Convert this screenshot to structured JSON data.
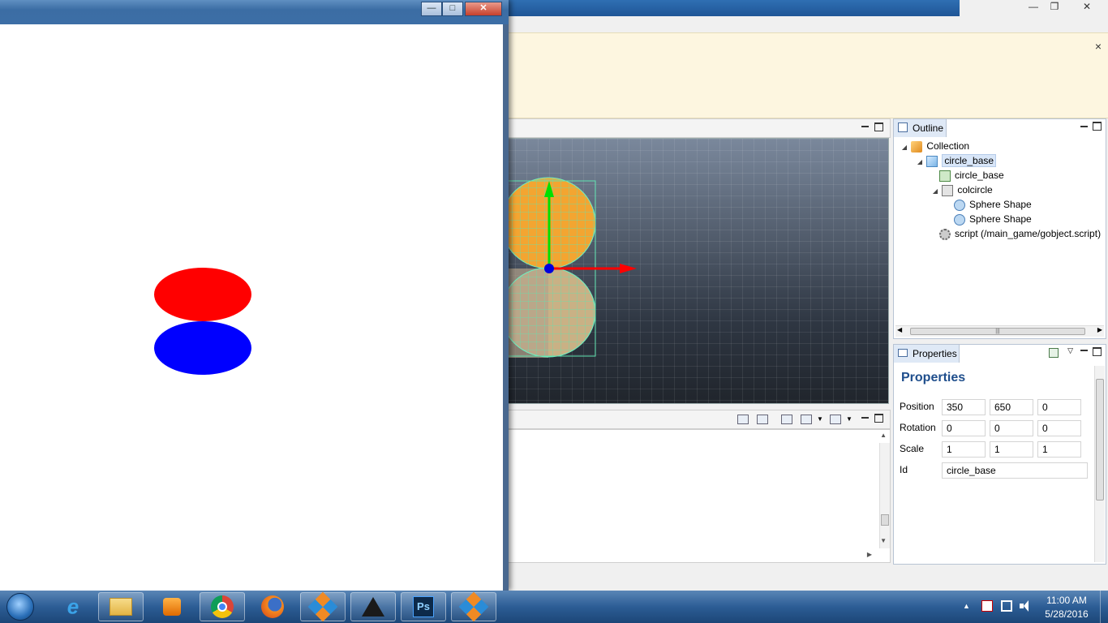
{
  "editor": {
    "notice_close": "×",
    "window_buttons": {
      "minimize": "—",
      "maximize": "❐",
      "close": "✕"
    }
  },
  "outline": {
    "tab_label": "Outline",
    "tree": [
      {
        "label": "Collection",
        "icon": "collection-icon",
        "arrow": "◢"
      },
      {
        "label": "circle_base",
        "icon": "gameobject-icon",
        "arrow": "◢",
        "selected": true
      },
      {
        "label": "circle_base",
        "icon": "sprite-icon"
      },
      {
        "label": "colcircle",
        "icon": "collision-icon",
        "arrow": "◢"
      },
      {
        "label": "Sphere Shape",
        "icon": "sphere-icon"
      },
      {
        "label": "Sphere Shape",
        "icon": "sphere-icon"
      },
      {
        "label": "script (/main_game/gobject.script)",
        "icon": "gear-icon"
      }
    ],
    "scroll_grip": "|||"
  },
  "properties": {
    "tab_label": "Properties",
    "title": "Properties",
    "rows": {
      "position": {
        "label": "Position",
        "x": "350",
        "y": "650",
        "z": "0"
      },
      "rotation": {
        "label": "Rotation",
        "x": "0",
        "y": "0",
        "z": "0"
      },
      "scale": {
        "label": "Scale",
        "x": "1",
        "y": "1",
        "z": "1"
      },
      "id": {
        "label": "Id",
        "value": "circle_base"
      }
    }
  },
  "game_window": {
    "buttons": {
      "minimize": "—",
      "maximize": "□",
      "close": "✕"
    },
    "circles": [
      {
        "color": "#ff0000"
      },
      {
        "color": "#0000ff"
      }
    ]
  },
  "taskbar": {
    "clock_time": "11:00 AM",
    "clock_date": "5/28/2016",
    "tray_arrow": "▲",
    "apps": [
      "start-orb",
      "internet-explorer-icon",
      "file-explorer-icon",
      "media-player-icon",
      "chrome-icon",
      "firefox-icon",
      "defold-icon",
      "inkscape-icon",
      "photoshop-icon",
      "defold-icon"
    ],
    "photoshop_label": "Ps"
  },
  "colors": {
    "accent": "#1f5596",
    "properties_title": "#1f4e8c",
    "notice_bg": "#fdf6e0"
  }
}
